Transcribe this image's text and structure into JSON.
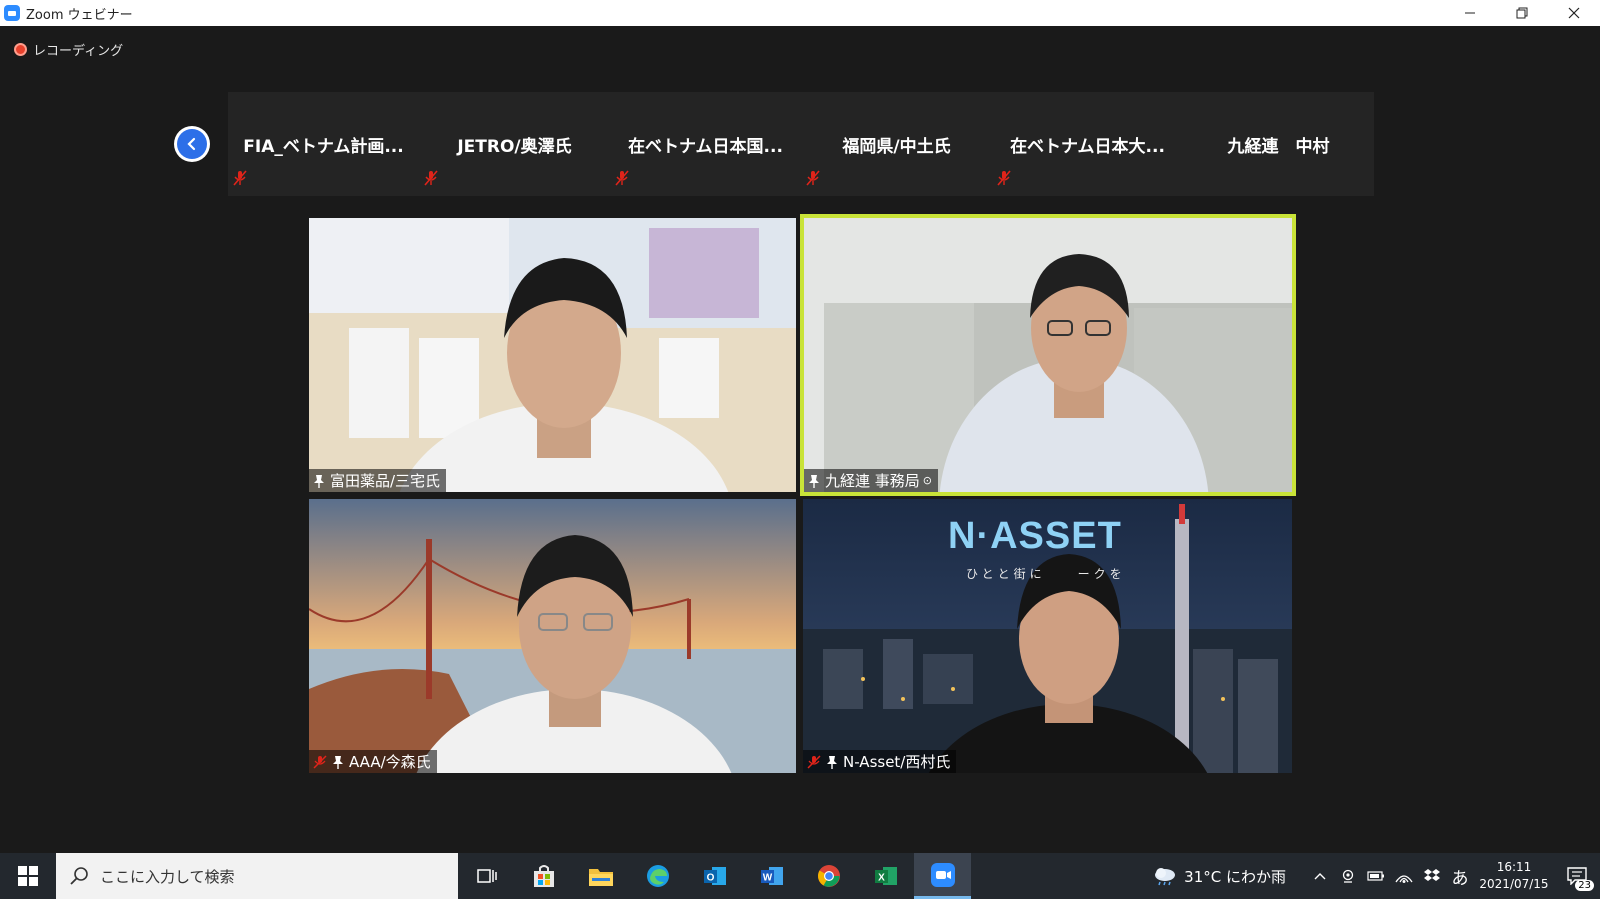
{
  "window": {
    "title": "Zoom ウェビナー",
    "controls": {
      "minimize": "–",
      "restore": "❐",
      "close": "✕"
    }
  },
  "recording": {
    "label": "レコーディング",
    "color": "#e8412c"
  },
  "strip": {
    "participants": [
      {
        "name": "FIA_ベトナム計画...",
        "muted": true
      },
      {
        "name": "JETRO/奥澤氏",
        "muted": true
      },
      {
        "name": "在ベトナム日本国...",
        "muted": true
      },
      {
        "name": "福岡県/中土氏",
        "muted": true
      },
      {
        "name": "在ベトナム日本大...",
        "muted": true
      },
      {
        "name": "九経連　中村",
        "muted": false
      }
    ]
  },
  "videos": [
    {
      "name": "富田薬品/三宅氏",
      "muted": false,
      "pinned": true,
      "active_speaker": false
    },
    {
      "name": "九経連 事務局",
      "muted": false,
      "pinned": true,
      "active_speaker": true,
      "highlight_color": "#c9e338"
    },
    {
      "name": "AAA/今森氏",
      "muted": true,
      "pinned": true,
      "active_speaker": false
    },
    {
      "name": "N-Asset/西村氏",
      "muted": true,
      "pinned": true,
      "active_speaker": false,
      "background_brand": "N·ASSET",
      "background_tagline": "ひとと街に　　ークを"
    }
  ],
  "taskbar": {
    "search_placeholder": "ここに入力して検索",
    "apps": [
      "task-view",
      "store",
      "file-explorer",
      "edge",
      "outlook",
      "word",
      "chrome",
      "excel",
      "zoom"
    ],
    "active_app": "zoom",
    "weather": "31°C にわか雨",
    "ime": "あ",
    "time": "16:11",
    "date": "2021/07/15",
    "notifications": "23"
  }
}
